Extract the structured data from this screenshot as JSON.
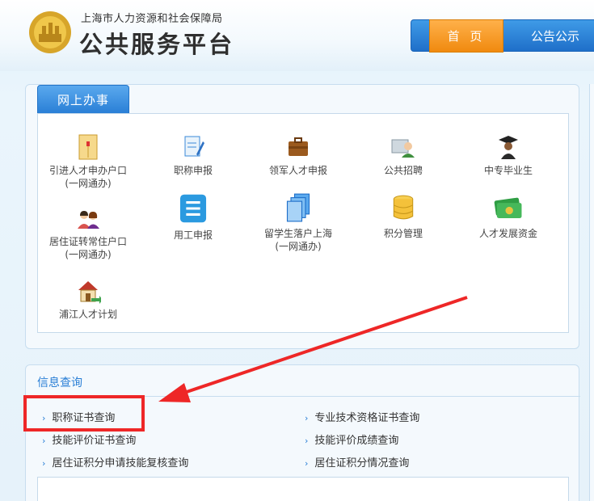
{
  "header": {
    "org_name": "上海市人力资源和社会保障局",
    "site_title": "公共服务平台"
  },
  "nav": {
    "home": "首 页",
    "notice": "公告公示"
  },
  "online": {
    "tab": "网上办事",
    "services": [
      {
        "label": "引进人才申办户口",
        "sub": "(一网通办)",
        "icon": "envelope-icon"
      },
      {
        "label": "职称申报",
        "sub": "",
        "icon": "document-pen-icon"
      },
      {
        "label": "领军人才申报",
        "sub": "",
        "icon": "briefcase-icon"
      },
      {
        "label": "公共招聘",
        "sub": "",
        "icon": "recruit-person-icon"
      },
      {
        "label": "中专毕业生",
        "sub": "",
        "icon": "graduate-icon"
      },
      {
        "label": "居住证转常住户口",
        "sub": "(一网通办)",
        "icon": "family-icon"
      },
      {
        "label": "用工申报",
        "sub": "",
        "icon": "list-icon"
      },
      {
        "label": "留学生落户上海",
        "sub": "(一网通办)",
        "icon": "stacked-docs-icon"
      },
      {
        "label": "积分管理",
        "sub": "",
        "icon": "database-icon"
      },
      {
        "label": "人才发展资金",
        "sub": "",
        "icon": "money-icon"
      },
      {
        "label": "浦江人才计划",
        "sub": "",
        "icon": "house-icon"
      }
    ]
  },
  "info": {
    "title": "信息查询",
    "links": [
      "职称证书查询",
      "专业技术资格证书查询",
      "技能评价证书查询",
      "技能评价成绩查询",
      "居住证积分申请技能复核查询",
      "居住证积分情况查询"
    ]
  },
  "colors": {
    "accent_blue": "#2a7fd6",
    "home_orange": "#f08a0f",
    "highlight_red": "#ee2727"
  }
}
